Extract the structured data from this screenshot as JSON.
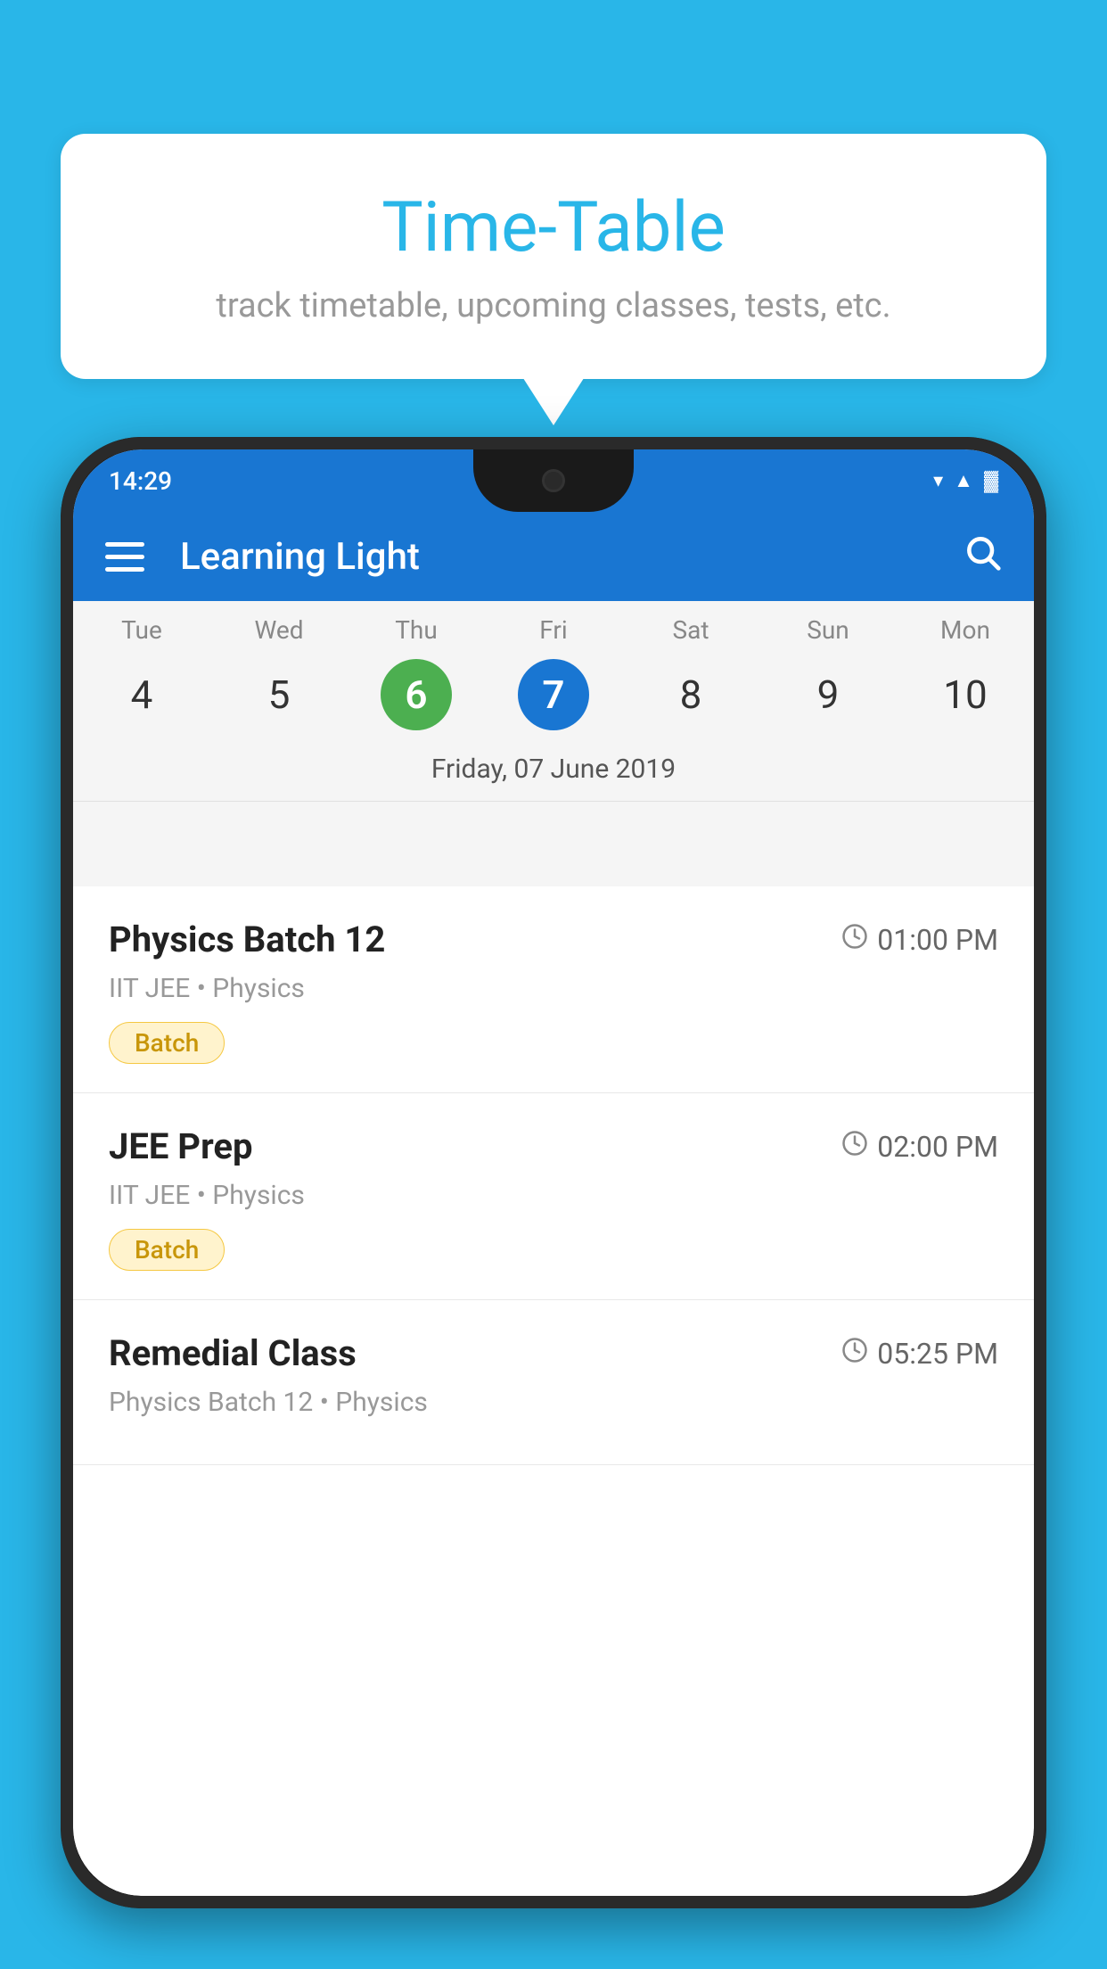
{
  "background_color": "#29b6e8",
  "speech_bubble": {
    "title": "Time-Table",
    "subtitle": "track timetable, upcoming classes, tests, etc."
  },
  "status_bar": {
    "time": "14:29"
  },
  "app_bar": {
    "title": "Learning Light"
  },
  "calendar": {
    "days": [
      {
        "label": "Tue",
        "number": "4",
        "state": "normal"
      },
      {
        "label": "Wed",
        "number": "5",
        "state": "normal"
      },
      {
        "label": "Thu",
        "number": "6",
        "state": "today"
      },
      {
        "label": "Fri",
        "number": "7",
        "state": "selected"
      },
      {
        "label": "Sat",
        "number": "8",
        "state": "normal"
      },
      {
        "label": "Sun",
        "number": "9",
        "state": "normal"
      },
      {
        "label": "Mon",
        "number": "10",
        "state": "normal"
      }
    ],
    "selected_date_label": "Friday, 07 June 2019"
  },
  "schedule_items": [
    {
      "title": "Physics Batch 12",
      "time": "01:00 PM",
      "subtitle": "IIT JEE • Physics",
      "tag": "Batch"
    },
    {
      "title": "JEE Prep",
      "time": "02:00 PM",
      "subtitle": "IIT JEE • Physics",
      "tag": "Batch"
    },
    {
      "title": "Remedial Class",
      "time": "05:25 PM",
      "subtitle": "Physics Batch 12 • Physics",
      "tag": ""
    }
  ],
  "icons": {
    "hamburger": "☰",
    "search": "🔍",
    "clock": "🕐",
    "wifi": "▲",
    "signal": "▲",
    "battery": "▓"
  }
}
